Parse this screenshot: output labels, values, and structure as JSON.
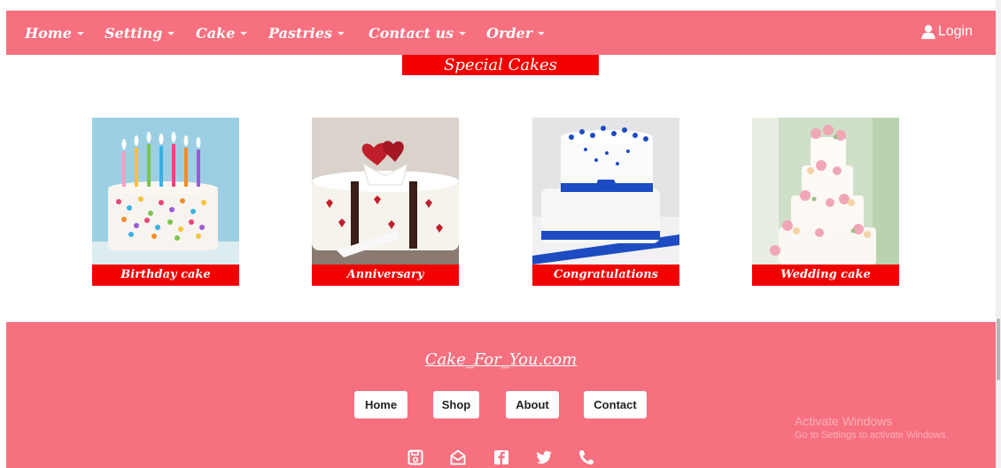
{
  "nav": {
    "items": [
      {
        "label": "Home"
      },
      {
        "label": "Setting"
      },
      {
        "label": "Cake"
      },
      {
        "label": "Pastries"
      },
      {
        "label": "Contact us"
      },
      {
        "label": "Order"
      }
    ],
    "login_label": "Login"
  },
  "section": {
    "title": "Special Cakes"
  },
  "cards": [
    {
      "label": "Birthday cake"
    },
    {
      "label": "Anniversary"
    },
    {
      "label": "Congratulations"
    },
    {
      "label": "Wedding cake"
    }
  ],
  "footer": {
    "brand": "Cake_For_You.com",
    "buttons": [
      {
        "label": "Home"
      },
      {
        "label": "Shop"
      },
      {
        "label": "About"
      },
      {
        "label": "Contact"
      }
    ],
    "icons": [
      "save-icon",
      "mail-icon",
      "facebook-icon",
      "twitter-icon",
      "phone-icon"
    ]
  },
  "watermark": {
    "line1": "Activate Windows",
    "line2": "Go to Settings to activate Windows."
  },
  "colors": {
    "brand_pink": "#f6707f",
    "label_red": "#f30000"
  }
}
